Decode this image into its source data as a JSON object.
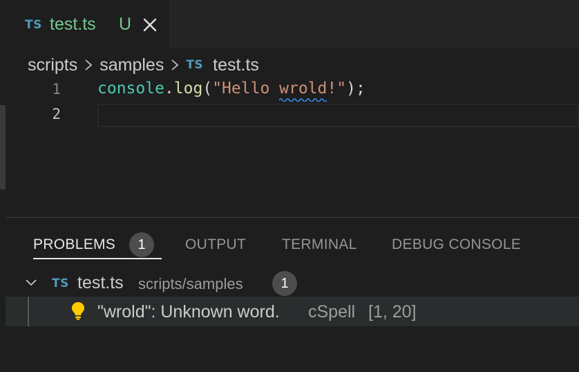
{
  "tab": {
    "lang_badge": "TS",
    "title": "test.ts",
    "status": "U"
  },
  "breadcrumb": {
    "segments": [
      "scripts",
      "samples"
    ],
    "file_badge": "TS",
    "file": "test.ts"
  },
  "editor": {
    "line_numbers": [
      "1",
      "2"
    ],
    "code": {
      "object": "console",
      "dot": ".",
      "method": "log",
      "open": "(",
      "str_start": "\"Hello ",
      "misspelled": "wrold",
      "str_end": "!\"",
      "close": ");"
    }
  },
  "panel": {
    "tabs": [
      {
        "label": "PROBLEMS",
        "badge": "1"
      },
      {
        "label": "OUTPUT"
      },
      {
        "label": "TERMINAL"
      },
      {
        "label": "DEBUG CONSOLE"
      }
    ],
    "file_row": {
      "lang_badge": "TS",
      "filename": "test.ts",
      "path": "scripts/samples",
      "count": "1"
    },
    "problem": {
      "message": "\"wrold\": Unknown word.",
      "source": "cSpell",
      "position": "[1, 20]"
    }
  },
  "colors": {
    "editor_bg": "#1e1e1e",
    "tab_modified": "#73c991",
    "ts_icon": "#519aba",
    "squiggle": "#3794ff",
    "bulb": "#ffcc00"
  }
}
